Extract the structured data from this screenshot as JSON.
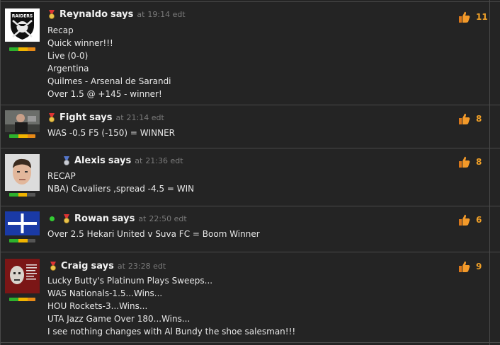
{
  "comments": [
    {
      "id": "reynaldo",
      "name": "Reynaldo",
      "says": "says",
      "at": "at",
      "time": "19:14 edt",
      "lines": [
        "Recap",
        "Quick winner!!!",
        "Live (0-0)",
        "Argentina",
        "Quilmes - Arsenal de Sarandi",
        "Over 1.5 @ +145 - winner!"
      ],
      "likes": "11",
      "avatar_text": "RAIDERS",
      "online": false
    },
    {
      "id": "fight",
      "name": "Fight",
      "says": "says",
      "at": "at",
      "time": "21:14 edt",
      "lines": [
        "WAS -0.5 F5 (-150) = WINNER"
      ],
      "likes": "8",
      "online": false
    },
    {
      "id": "alexis",
      "name": "Alexis",
      "says": "says",
      "at": "at",
      "time": "21:36 edt",
      "lines": [
        "RECAP",
        "NBA) Cavaliers ,spread -4.5 = WIN"
      ],
      "likes": "8",
      "online": false
    },
    {
      "id": "rowan",
      "name": "Rowan",
      "says": "says",
      "at": "at",
      "time": "22:50 edt",
      "lines": [
        "Over 2.5 Hekari United v Suva FC = Boom Winner"
      ],
      "likes": "6",
      "online": true
    },
    {
      "id": "craig",
      "name": "Craig",
      "says": "says",
      "at": "at",
      "time": "23:28 edt",
      "lines": [
        "Lucky Butty's Platinum Plays Sweeps...",
        "WAS Nationals-1.5...Wins...",
        "HOU Rockets-3...Wins...",
        "UTA Jazz Game Over 180...Wins...",
        "I see nothing changes with Al Bundy the shoe salesman!!!"
      ],
      "likes": "9",
      "online": false
    }
  ],
  "colors": {
    "background": "#242424",
    "like_count": "#f0a028",
    "online": "#33cc33"
  },
  "icons": {
    "like": "thumbs-up-icon",
    "rank": "medal-badge-icon"
  }
}
